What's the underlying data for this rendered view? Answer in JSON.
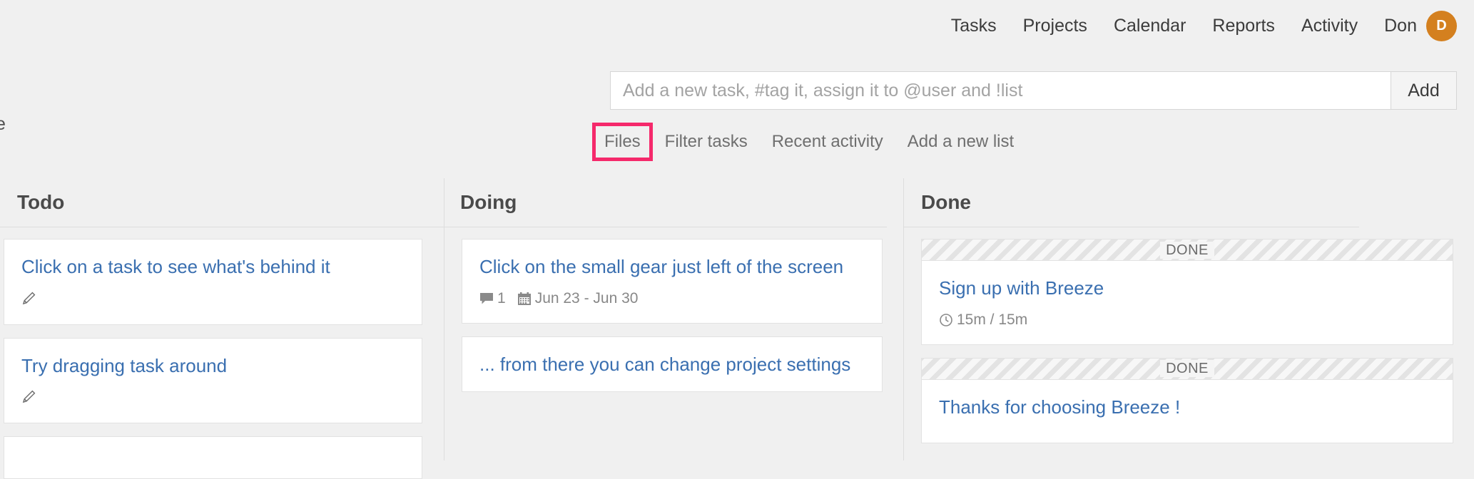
{
  "topnav": {
    "items": [
      {
        "label": "Tasks",
        "name": "nav-tasks"
      },
      {
        "label": "Projects",
        "name": "nav-projects"
      },
      {
        "label": "Calendar",
        "name": "nav-calendar"
      },
      {
        "label": "Reports",
        "name": "nav-reports"
      },
      {
        "label": "Activity",
        "name": "nav-activity"
      }
    ],
    "user": {
      "name": "Don",
      "avatar_initial": "D",
      "avatar_color": "#d4801f"
    }
  },
  "addbar": {
    "placeholder": "Add a new task, #tag it, assign it to @user and !list",
    "value": "",
    "button_label": "Add"
  },
  "tabs": {
    "highlight_color": "#f5296b",
    "items": [
      {
        "label": "Files",
        "highlighted": true
      },
      {
        "label": "Filter tasks",
        "highlighted": false
      },
      {
        "label": "Recent activity",
        "highlighted": false
      },
      {
        "label": "Add a new list",
        "highlighted": false
      }
    ]
  },
  "clipped_left_text": "e",
  "board": {
    "columns": [
      {
        "title": "Todo",
        "cards": [
          {
            "title": "Click on a task to see what's behind it",
            "has_edit_icon": true,
            "meta": []
          },
          {
            "title": "Try dragging task around",
            "has_edit_icon": true,
            "meta": []
          },
          {
            "title": "",
            "has_edit_icon": false,
            "meta": []
          }
        ]
      },
      {
        "title": "Doing",
        "cards": [
          {
            "title": "Click on the small gear just left of the screen",
            "has_edit_icon": false,
            "meta": [
              {
                "icon": "comment-icon",
                "text": "1"
              },
              {
                "icon": "calendar-icon",
                "text": "Jun 23 - Jun 30"
              }
            ]
          },
          {
            "title": "... from there you can change project settings",
            "has_edit_icon": false,
            "meta": []
          }
        ]
      },
      {
        "title": "Done",
        "cards": [
          {
            "done_banner": "DONE",
            "title": "Sign up with Breeze",
            "has_edit_icon": false,
            "meta": [
              {
                "icon": "clock-icon",
                "text": "15m / 15m"
              }
            ]
          },
          {
            "done_banner": "DONE",
            "title": "Thanks for choosing Breeze !",
            "has_edit_icon": false,
            "meta": []
          }
        ]
      }
    ]
  }
}
